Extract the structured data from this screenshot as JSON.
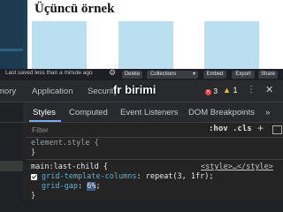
{
  "preview": {
    "title": "Üçüncü örnek"
  },
  "footer": {
    "saved_text": "Last saved less than a minute ago",
    "buttons": [
      "Delete",
      "Collections",
      "Embed",
      "Export",
      "Share"
    ]
  },
  "devtools": {
    "top_tabs": [
      "mory",
      "Application",
      "Security"
    ],
    "overlay_label": "fr birimi",
    "error_count": "3",
    "warning_count": "1",
    "sub_tabs": [
      "Styles",
      "Computed",
      "Event Listeners",
      "DOM Breakpoints",
      "»"
    ],
    "filter_placeholder": "Filter",
    "hov_label": ":hov",
    "cls_label": ".cls",
    "rules": {
      "element_style": "element.style {",
      "close_brace": "}",
      "selector": "main:last-child {",
      "origin": "<style>…</style>",
      "declarations": [
        {
          "prop": "grid-template-columns",
          "value": "repeat(3, 1fr);"
        },
        {
          "prop": "grid-gap",
          "value": "6%",
          "suffix": ";"
        }
      ]
    }
  },
  "colors": {
    "preview_cell": "#b9dff0",
    "accent_tab": "#7cacf8",
    "css_property": "#5db0d7"
  }
}
